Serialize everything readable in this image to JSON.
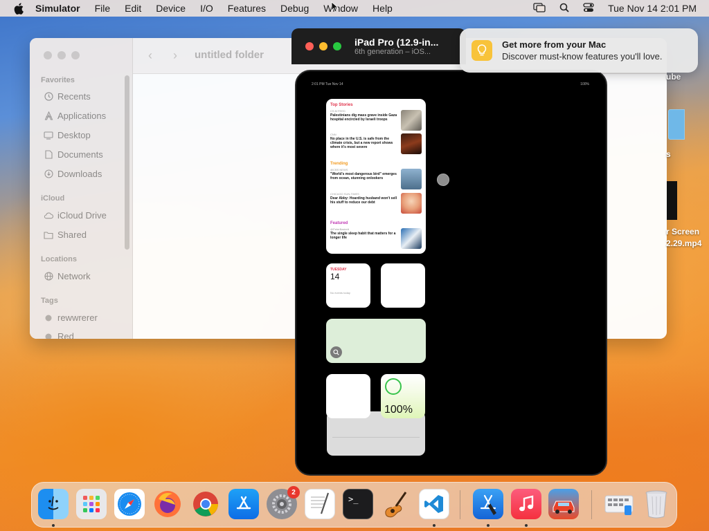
{
  "menubar": {
    "app_name": "Simulator",
    "items": [
      "File",
      "Edit",
      "Device",
      "I/O",
      "Features",
      "Debug",
      "Window",
      "Help"
    ],
    "clock": "Tue Nov 14  2:01 PM"
  },
  "finder": {
    "folder_title": "untitled folder",
    "sections": {
      "favorites": "Favorites",
      "icloud": "iCloud",
      "locations": "Locations",
      "tags": "Tags"
    },
    "favorites": [
      "Recents",
      "Applications",
      "Desktop",
      "Documents",
      "Downloads"
    ],
    "icloud_items": [
      "iCloud Drive",
      "Shared"
    ],
    "locations_items": [
      "Network"
    ],
    "tags_items": [
      "rewwrerer",
      "Red"
    ]
  },
  "simulator": {
    "device_name": "iPad Pro (12.9-in...",
    "device_subtitle": "6th generation – iOS..."
  },
  "ipad": {
    "status_time": "2:01 PM   Tue Nov 14",
    "status_battery": "100%",
    "news": {
      "top_stories": "Top Stories",
      "trending": "Trending",
      "featured": "Featured",
      "items": [
        {
          "source": "CS.M FEED",
          "headline": "Palestinians dig mass grave inside Gaza hospital encircled by Israeli troops"
        },
        {
          "source": "CNN",
          "headline": "No place in the U.S. is safe from the climate crisis, but a new report shows where it's most severe"
        },
        {
          "source": "@CBS NEWS",
          "headline": "\"World's most dangerous bird\" emerges from ocean, stunning onlookers"
        },
        {
          "source": "CHICAGO SUN-TIMES",
          "headline": "Dear Abby: Hoarding husband won't sell his stuff to reduce our debt"
        },
        {
          "source": "@PeterBaskett",
          "headline": "The single sleep habit that matters for a longer life"
        }
      ]
    },
    "calendar": {
      "day": "TUESDAY",
      "date": "14",
      "note": "No events today"
    },
    "battery_widget": "100%"
  },
  "notification": {
    "title": "Get more from your Mac",
    "body": "Discover must-know features you'll love."
  },
  "desktop": {
    "label_ube": "ube",
    "label_s": "s",
    "label_screen": "r Screen",
    "label_mp4": "2.29.mp4"
  },
  "dock": {
    "settings_badge": "2",
    "apps": [
      "finder-icon",
      "launchpad-icon",
      "safari-icon",
      "firefox-icon",
      "chrome-icon",
      "app-store-icon",
      "system-settings-icon",
      "textedit-icon",
      "terminal-icon",
      "garageband-icon",
      "vscode-icon",
      "xcode-icon",
      "music-icon",
      "game-icon",
      "downloads-stack-icon",
      "trash-icon"
    ]
  },
  "colors": {
    "accent_orange": "#f08d2b",
    "notification_icon": "#f8c33a",
    "red_light": "#fe5f57",
    "yellow_light": "#febc2e",
    "green_light": "#28c840"
  }
}
